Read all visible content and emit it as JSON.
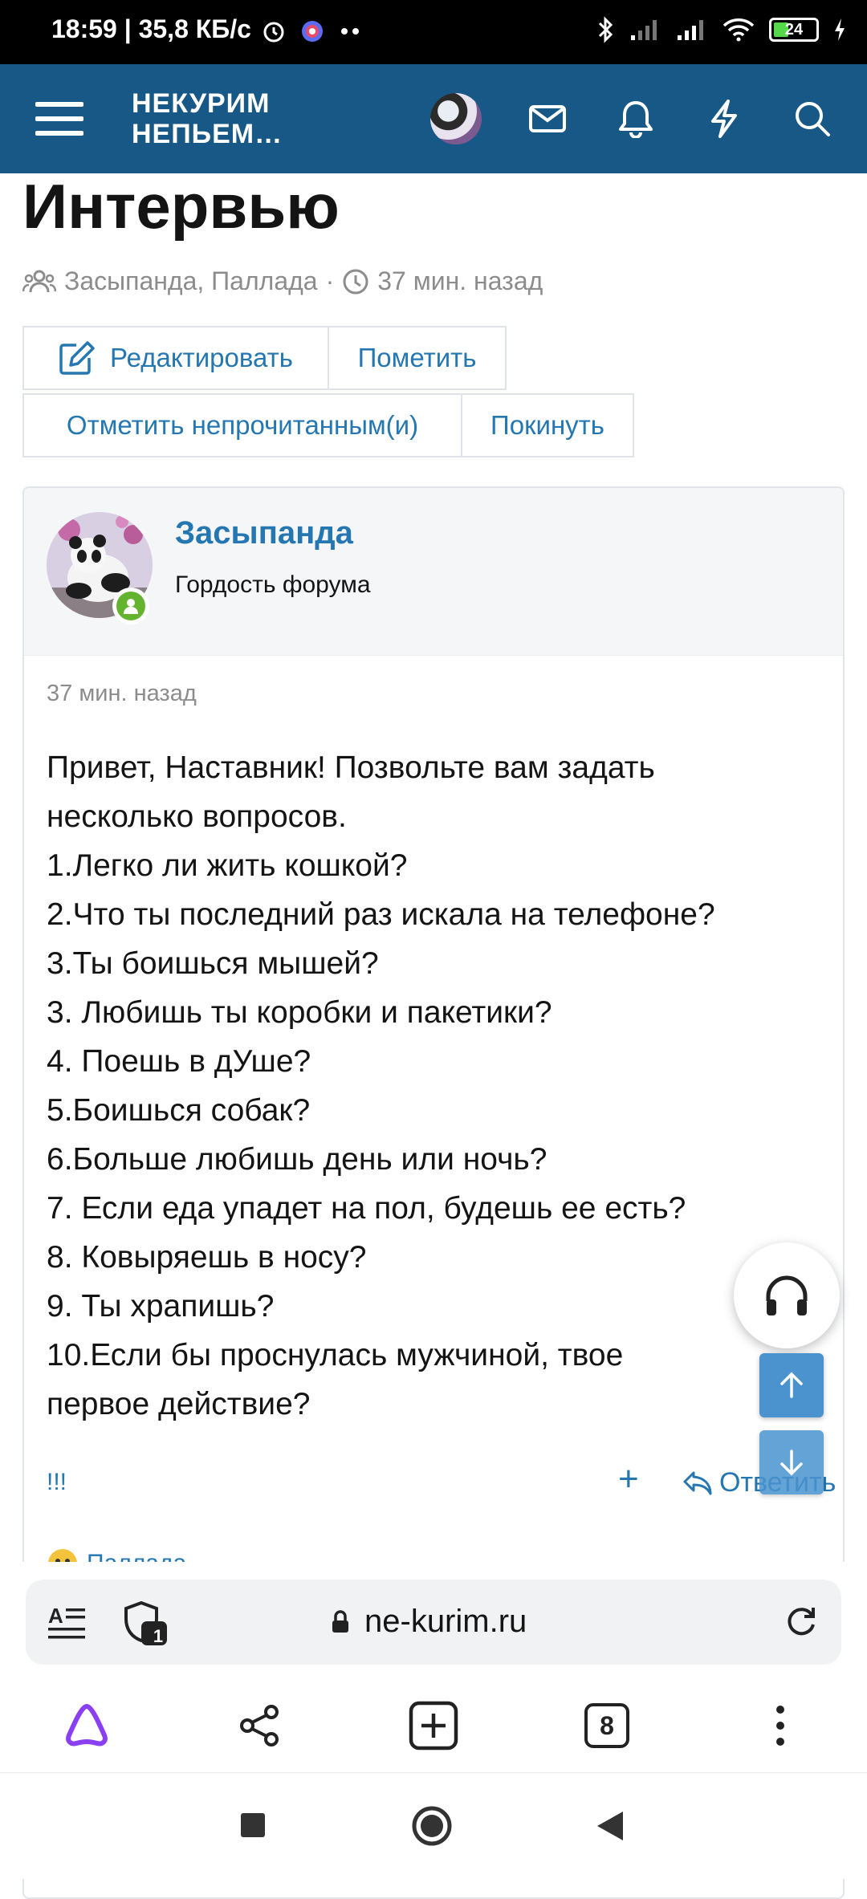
{
  "status_bar": {
    "time_speed": "18:59 | 35,8 КБ/с",
    "battery": "24"
  },
  "header": {
    "logo_line1": "НЕКУРИМ",
    "logo_line2": "НЕПЬЕМ…"
  },
  "thread": {
    "title": "Интервью",
    "participants": "Засыпанда, Паллада",
    "separator": "·",
    "time": "37 мин. назад"
  },
  "actions": {
    "edit": "Редактировать",
    "mark": "Пометить",
    "mark_unread": "Отметить непрочитанным(и)",
    "leave": "Покинуть"
  },
  "post": {
    "author": "Засыпанда",
    "author_title": "Гордость форума",
    "time": "37 мин. назад",
    "lines": [
      "Привет, Наставник! Позвольте вам задать",
      "несколько вопросов.",
      "1.Легко ли жить кошкой?",
      "2.Что ты последний раз искала на телефоне?",
      "3.Ты боишься мышей?",
      "3. Любишь ты коробки и пакетики?",
      "4. Поешь в дУше?",
      "5.Боишься собак?",
      "6.Больше любишь день или ночь?",
      "7. Если еда упадет на пол, будешь ее есть?",
      "8. Ковыряешь в носу?",
      "9. Ты храпишь?",
      "10.Если бы проснулась мужчиной, твое",
      "первое действие?"
    ],
    "reaction": "!!!",
    "plus": "+",
    "reply": "Ответить"
  },
  "next_post": {
    "author": "Паллада"
  },
  "browser": {
    "url": "ne-kurim.ru",
    "shield_count": "1",
    "tabs_count": "8"
  },
  "colors": {
    "header_bg": "#185886",
    "link": "#2577b1",
    "online": "#63b32e",
    "scroll_button": "#4a93cf"
  },
  "icons": [
    "menu-icon",
    "mail-icon",
    "bell-icon",
    "bolt-icon",
    "search-icon",
    "users-icon",
    "clock-icon",
    "edit-icon",
    "headphones-icon",
    "arrow-up-icon",
    "arrow-down-icon",
    "reply-icon",
    "reader-icon",
    "shield-icon",
    "lock-icon",
    "reload-icon",
    "alice-icon",
    "share-icon",
    "new-tab-icon",
    "more-icon"
  ]
}
